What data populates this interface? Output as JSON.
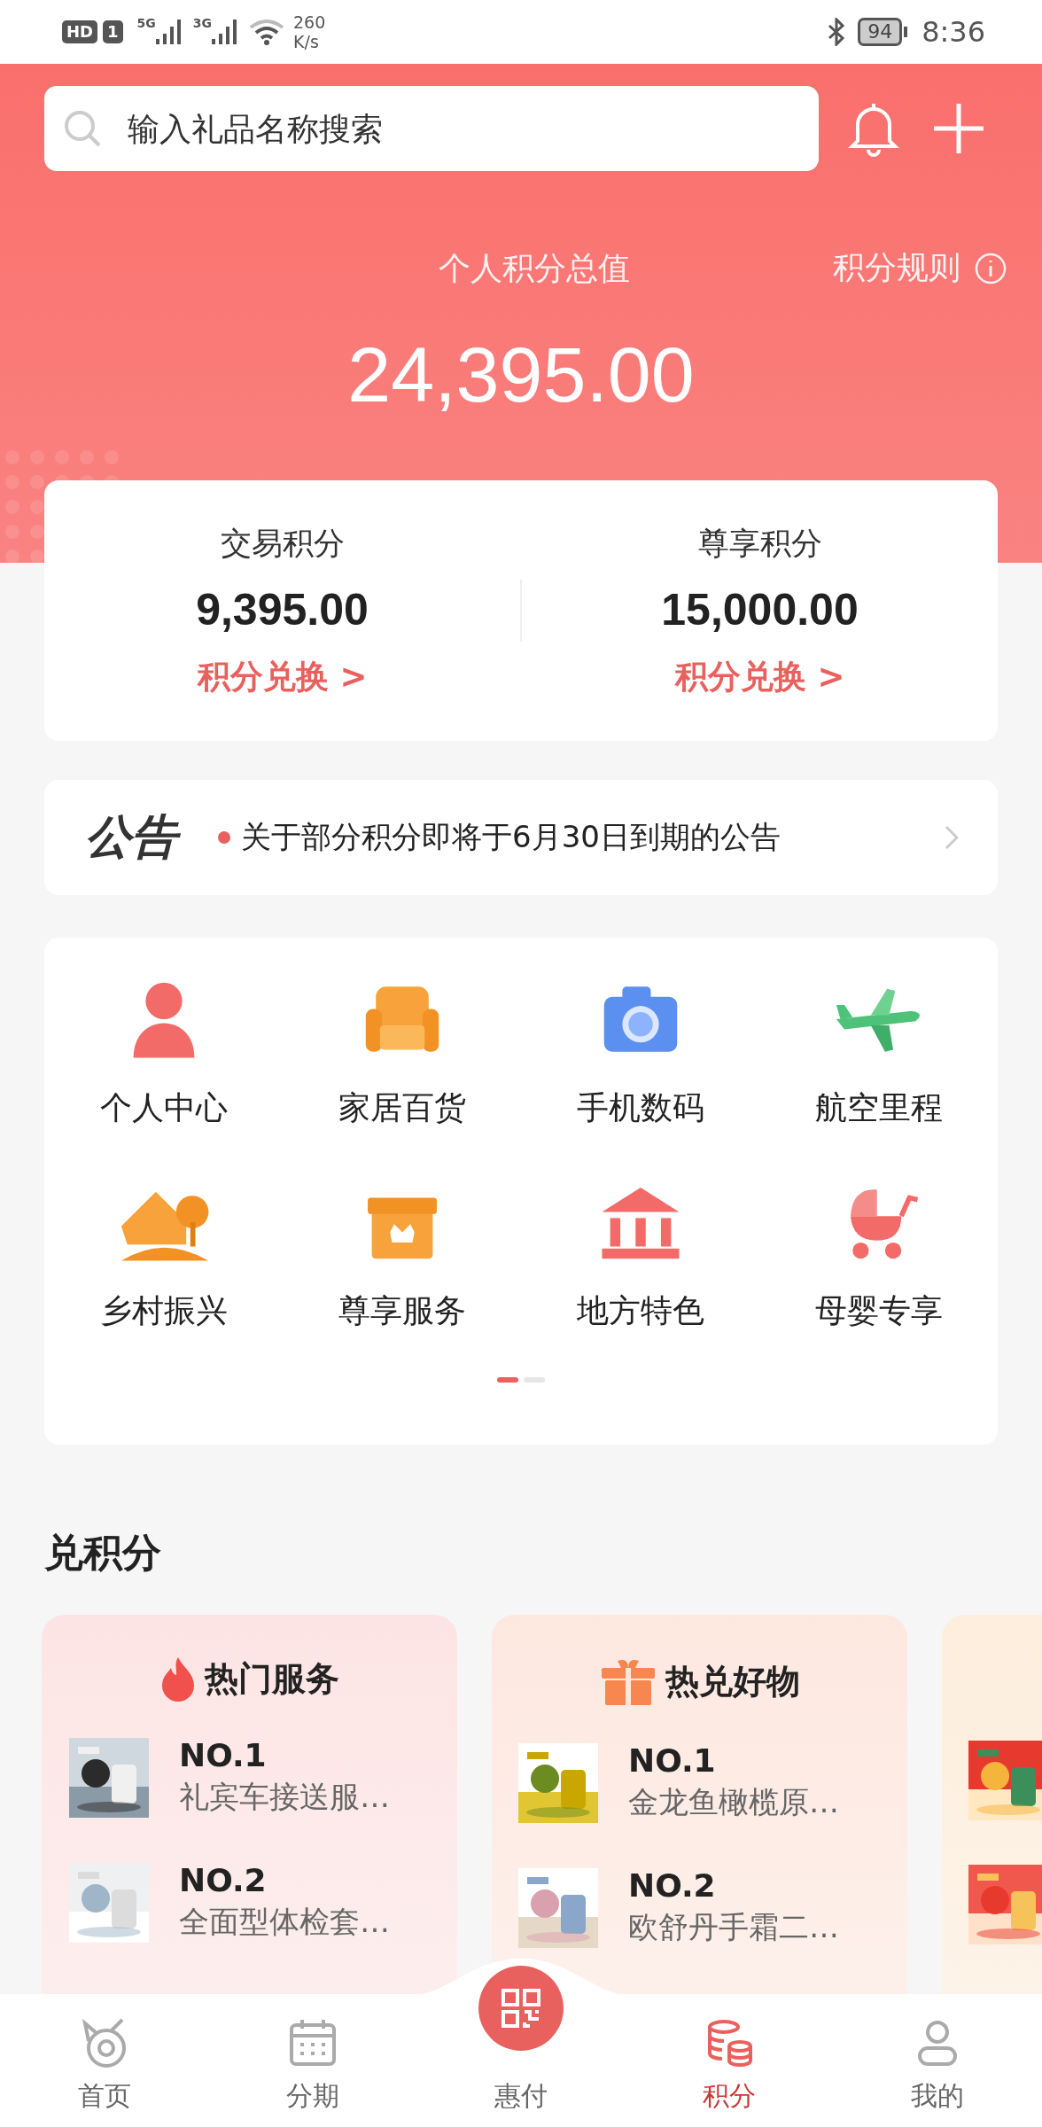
{
  "status_bar": {
    "hd": "HD",
    "sim": "1",
    "net_1": "5G",
    "net_2": "3G",
    "speed": "260",
    "speed_unit": "K/s",
    "battery": "94",
    "time": "8:36"
  },
  "search": {
    "placeholder": "输入礼品名称搜索"
  },
  "points": {
    "title": "个人积分总值",
    "rules": "积分规则",
    "total": "24,395.00"
  },
  "accounts": [
    {
      "label": "交易积分",
      "value": "9,395.00",
      "action": "积分兑换 >"
    },
    {
      "label": "尊享积分",
      "value": "15,000.00",
      "action": "积分兑换 >"
    }
  ],
  "notice": {
    "badge": "公告",
    "text": "关于部分积分即将于6月30日到期的公告"
  },
  "categories": [
    {
      "label": "个人中心"
    },
    {
      "label": "家居百货"
    },
    {
      "label": "手机数码"
    },
    {
      "label": "航空里程"
    },
    {
      "label": "乡村振兴"
    },
    {
      "label": "尊享服务"
    },
    {
      "label": "地方特色"
    },
    {
      "label": "母婴专享"
    }
  ],
  "pager": [
    {
      "selected": true
    },
    {
      "selected": false
    }
  ],
  "section_title": "兑积分",
  "rank_cards": [
    {
      "kind": "list",
      "title": "热门服务",
      "items": [
        {
          "rank": "NO.1",
          "name": "礼宾车接送服…"
        },
        {
          "rank": "NO.2",
          "name": "全面型体检套…"
        }
      ]
    },
    {
      "kind": "list",
      "title": "热兑好物",
      "items": [
        {
          "rank": "NO.1",
          "name": "金龙鱼橄榄原…"
        },
        {
          "rank": "NO.2",
          "name": "欧舒丹手霜二…"
        }
      ]
    },
    {
      "kind": "pictures"
    }
  ],
  "tabbar": [
    {
      "label": "首页",
      "selected": false
    },
    {
      "label": "分期",
      "selected": false
    },
    {
      "label": "惠付",
      "selected": false,
      "kind": "center"
    },
    {
      "label": "积分",
      "selected": true
    },
    {
      "label": "我的",
      "selected": false
    }
  ]
}
